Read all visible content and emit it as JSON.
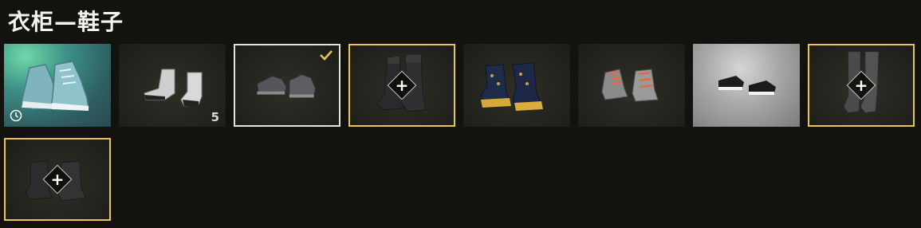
{
  "header": {
    "title": "衣柜—鞋子"
  },
  "items": [
    {
      "id": "item1",
      "variant": "rare",
      "badge": "clock-icon",
      "count": "",
      "selected": false,
      "equipped_slot": false
    },
    {
      "id": "item2",
      "variant": "dark",
      "badge": "",
      "count": "5",
      "selected": false,
      "equipped_slot": false
    },
    {
      "id": "item3",
      "variant": "dark",
      "badge": "checkmark-icon",
      "count": "",
      "selected": true,
      "equipped_slot": false
    },
    {
      "id": "item4",
      "variant": "dark",
      "badge": "plus-icon",
      "count": "",
      "selected": false,
      "equipped_slot": true
    },
    {
      "id": "item5",
      "variant": "dark",
      "badge": "",
      "count": "",
      "selected": false,
      "equipped_slot": false
    },
    {
      "id": "item6",
      "variant": "dark",
      "badge": "",
      "count": "",
      "selected": false,
      "equipped_slot": false
    },
    {
      "id": "item7",
      "variant": "light",
      "badge": "",
      "count": "",
      "selected": false,
      "equipped_slot": false
    },
    {
      "id": "item8",
      "variant": "dark",
      "badge": "plus-icon",
      "count": "",
      "selected": false,
      "equipped_slot": true
    },
    {
      "id": "item9",
      "variant": "dark",
      "badge": "plus-icon",
      "count": "",
      "selected": false,
      "equipped_slot": true
    }
  ],
  "colors": {
    "background": "#13120e",
    "gold_border": "#e8c45e",
    "selected_border": "#e4e4e2",
    "rare_background": "#3c8f86"
  }
}
